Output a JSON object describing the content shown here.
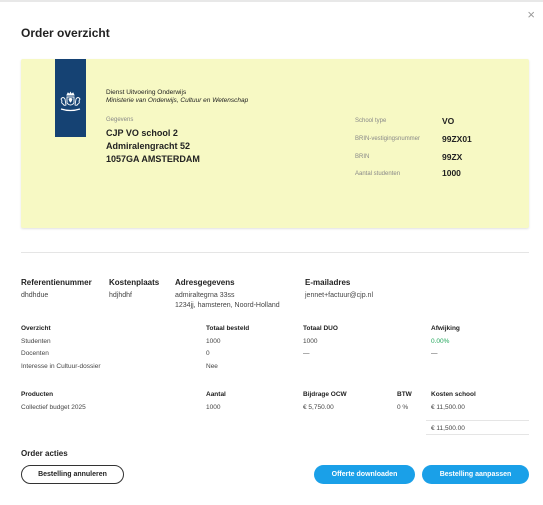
{
  "modal": {
    "title": "Order overzicht",
    "close_label": "×"
  },
  "card": {
    "org_name": "Dienst Uitvoering Onderwijs",
    "org_sub": "Ministerie van Onderwijs, Cultuur en Wetenschap",
    "gegevens_label": "Gegevens",
    "school_name": "CJP VO school 2",
    "street": "Admiralengracht 52",
    "city": "1057GA AMSTERDAM",
    "school_type_label": "School type",
    "school_type": "VO",
    "brin_vestiging_label": "BRIN-vestigingsnummer",
    "brin_vestiging": "99ZX01",
    "brin_label": "BRIN",
    "brin": "99ZX",
    "studenten_label": "Aantal studenten",
    "studenten": "1000",
    "ribbon_color": "#154273",
    "background_color": "#f7f9c4"
  },
  "info": {
    "referentie_label": "Referentienummer",
    "referentie": "dhdhdue",
    "kostenplaats_label": "Kostenplaats",
    "kostenplaats": "hdjhdhf",
    "adres_label": "Adresgegevens",
    "adres_line1": "admiraltegrna 33ss",
    "adres_line2": "1234jj, hamsteren, Noord-Holland",
    "email_label": "E-mailadres",
    "email": "jennet+factuur@cjp.nl"
  },
  "overzicht": {
    "headers": [
      "Overzicht",
      "Totaal besteld",
      "Totaal DUO",
      "Afwijking"
    ],
    "rows": [
      [
        "Studenten",
        "1000",
        "1000",
        "0.00%"
      ],
      [
        "Docenten",
        "0",
        "—",
        "—"
      ],
      [
        "Interesse in Cultuur-dossier",
        "Nee",
        "",
        ""
      ]
    ]
  },
  "producten": {
    "headers": [
      "Producten",
      "Aantal",
      "Bijdrage OCW",
      "BTW",
      "Kosten school"
    ],
    "rows": [
      [
        "Collectief budget 2025",
        "1000",
        "€ 5,750.00",
        "0 %",
        "€ 11,500.00"
      ]
    ],
    "total": "€ 11,500.00"
  },
  "actions": {
    "heading": "Order acties",
    "cancel_label": "Bestelling annuleren",
    "download_label": "Offerte downloaden",
    "edit_label": "Bestelling aanpassen",
    "primary_color": "#1aa0e8"
  }
}
